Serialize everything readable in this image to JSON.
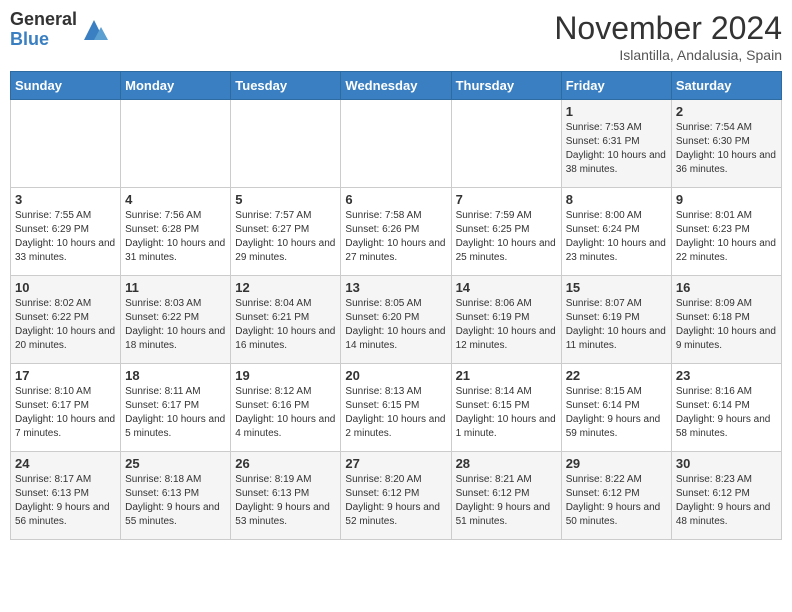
{
  "header": {
    "logo_general": "General",
    "logo_blue": "Blue",
    "month_title": "November 2024",
    "location": "Islantilla, Andalusia, Spain"
  },
  "days_of_week": [
    "Sunday",
    "Monday",
    "Tuesday",
    "Wednesday",
    "Thursday",
    "Friday",
    "Saturday"
  ],
  "weeks": [
    {
      "days": [
        {
          "num": "",
          "info": ""
        },
        {
          "num": "",
          "info": ""
        },
        {
          "num": "",
          "info": ""
        },
        {
          "num": "",
          "info": ""
        },
        {
          "num": "",
          "info": ""
        },
        {
          "num": "1",
          "info": "Sunrise: 7:53 AM\nSunset: 6:31 PM\nDaylight: 10 hours and 38 minutes."
        },
        {
          "num": "2",
          "info": "Sunrise: 7:54 AM\nSunset: 6:30 PM\nDaylight: 10 hours and 36 minutes."
        }
      ]
    },
    {
      "days": [
        {
          "num": "3",
          "info": "Sunrise: 7:55 AM\nSunset: 6:29 PM\nDaylight: 10 hours and 33 minutes."
        },
        {
          "num": "4",
          "info": "Sunrise: 7:56 AM\nSunset: 6:28 PM\nDaylight: 10 hours and 31 minutes."
        },
        {
          "num": "5",
          "info": "Sunrise: 7:57 AM\nSunset: 6:27 PM\nDaylight: 10 hours and 29 minutes."
        },
        {
          "num": "6",
          "info": "Sunrise: 7:58 AM\nSunset: 6:26 PM\nDaylight: 10 hours and 27 minutes."
        },
        {
          "num": "7",
          "info": "Sunrise: 7:59 AM\nSunset: 6:25 PM\nDaylight: 10 hours and 25 minutes."
        },
        {
          "num": "8",
          "info": "Sunrise: 8:00 AM\nSunset: 6:24 PM\nDaylight: 10 hours and 23 minutes."
        },
        {
          "num": "9",
          "info": "Sunrise: 8:01 AM\nSunset: 6:23 PM\nDaylight: 10 hours and 22 minutes."
        }
      ]
    },
    {
      "days": [
        {
          "num": "10",
          "info": "Sunrise: 8:02 AM\nSunset: 6:22 PM\nDaylight: 10 hours and 20 minutes."
        },
        {
          "num": "11",
          "info": "Sunrise: 8:03 AM\nSunset: 6:22 PM\nDaylight: 10 hours and 18 minutes."
        },
        {
          "num": "12",
          "info": "Sunrise: 8:04 AM\nSunset: 6:21 PM\nDaylight: 10 hours and 16 minutes."
        },
        {
          "num": "13",
          "info": "Sunrise: 8:05 AM\nSunset: 6:20 PM\nDaylight: 10 hours and 14 minutes."
        },
        {
          "num": "14",
          "info": "Sunrise: 8:06 AM\nSunset: 6:19 PM\nDaylight: 10 hours and 12 minutes."
        },
        {
          "num": "15",
          "info": "Sunrise: 8:07 AM\nSunset: 6:19 PM\nDaylight: 10 hours and 11 minutes."
        },
        {
          "num": "16",
          "info": "Sunrise: 8:09 AM\nSunset: 6:18 PM\nDaylight: 10 hours and 9 minutes."
        }
      ]
    },
    {
      "days": [
        {
          "num": "17",
          "info": "Sunrise: 8:10 AM\nSunset: 6:17 PM\nDaylight: 10 hours and 7 minutes."
        },
        {
          "num": "18",
          "info": "Sunrise: 8:11 AM\nSunset: 6:17 PM\nDaylight: 10 hours and 5 minutes."
        },
        {
          "num": "19",
          "info": "Sunrise: 8:12 AM\nSunset: 6:16 PM\nDaylight: 10 hours and 4 minutes."
        },
        {
          "num": "20",
          "info": "Sunrise: 8:13 AM\nSunset: 6:15 PM\nDaylight: 10 hours and 2 minutes."
        },
        {
          "num": "21",
          "info": "Sunrise: 8:14 AM\nSunset: 6:15 PM\nDaylight: 10 hours and 1 minute."
        },
        {
          "num": "22",
          "info": "Sunrise: 8:15 AM\nSunset: 6:14 PM\nDaylight: 9 hours and 59 minutes."
        },
        {
          "num": "23",
          "info": "Sunrise: 8:16 AM\nSunset: 6:14 PM\nDaylight: 9 hours and 58 minutes."
        }
      ]
    },
    {
      "days": [
        {
          "num": "24",
          "info": "Sunrise: 8:17 AM\nSunset: 6:13 PM\nDaylight: 9 hours and 56 minutes."
        },
        {
          "num": "25",
          "info": "Sunrise: 8:18 AM\nSunset: 6:13 PM\nDaylight: 9 hours and 55 minutes."
        },
        {
          "num": "26",
          "info": "Sunrise: 8:19 AM\nSunset: 6:13 PM\nDaylight: 9 hours and 53 minutes."
        },
        {
          "num": "27",
          "info": "Sunrise: 8:20 AM\nSunset: 6:12 PM\nDaylight: 9 hours and 52 minutes."
        },
        {
          "num": "28",
          "info": "Sunrise: 8:21 AM\nSunset: 6:12 PM\nDaylight: 9 hours and 51 minutes."
        },
        {
          "num": "29",
          "info": "Sunrise: 8:22 AM\nSunset: 6:12 PM\nDaylight: 9 hours and 50 minutes."
        },
        {
          "num": "30",
          "info": "Sunrise: 8:23 AM\nSunset: 6:12 PM\nDaylight: 9 hours and 48 minutes."
        }
      ]
    }
  ]
}
